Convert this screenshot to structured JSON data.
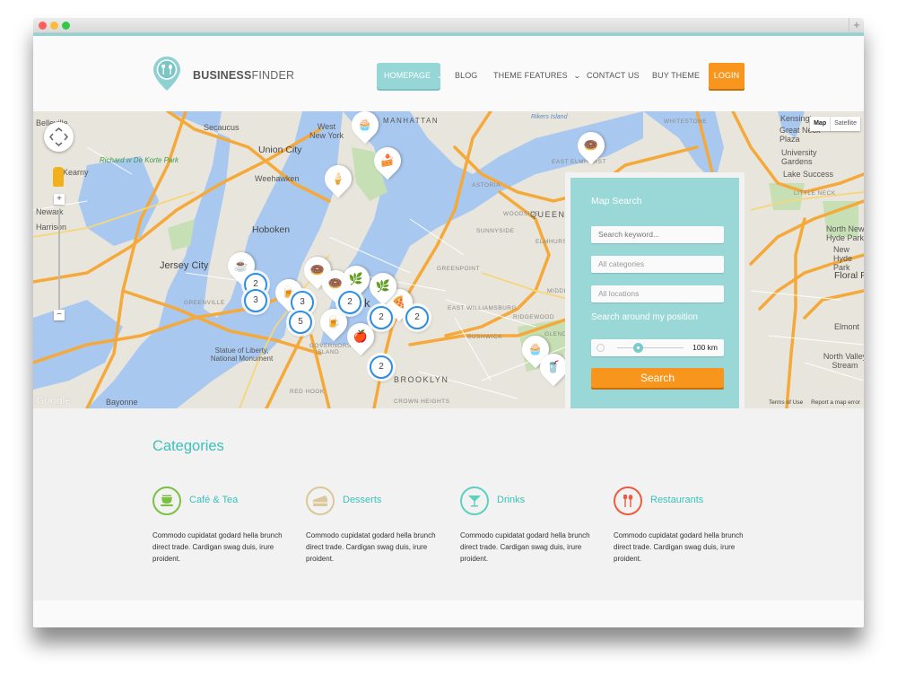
{
  "window": {
    "plus_label": "+"
  },
  "brand": {
    "bold": "BUSINESS",
    "light": "FINDER"
  },
  "nav": {
    "items": [
      {
        "label": "HOMEPAGE",
        "has_dropdown": true,
        "active": true
      },
      {
        "label": "BLOG",
        "has_dropdown": false
      },
      {
        "label": "THEME FEATURES",
        "has_dropdown": true
      },
      {
        "label": "CONTACT US",
        "has_dropdown": false
      },
      {
        "label": "BUY THEME",
        "has_dropdown": false
      }
    ],
    "login_label": "LOGIN",
    "chevron": "⌄"
  },
  "map": {
    "type_options": [
      "Map",
      "Satellite"
    ],
    "selected_type": "Map",
    "zoom_in": "+",
    "zoom_out": "−",
    "attribution": {
      "terms": "Terms of Use",
      "report": "Report a map error"
    },
    "logo": "Google",
    "labels": {
      "belleville": "Belleville",
      "secaucus": "Secaucus",
      "west_new_york": "West New York",
      "union_city": "Union City",
      "weehawken": "Weehawken",
      "hoboken": "Hoboken",
      "jersey_city": "Jersey City",
      "kearny": "Kearny",
      "newark": "Newark",
      "harrison": "Harrison",
      "bayonne": "Bayonne",
      "statue": "Statue of Liberty, National Monument",
      "richard_park": "Richard w De Korte Park",
      "manhattan": "MANHATTAN",
      "new_york": "York",
      "rikers": "Rikers Island",
      "east_elmhurst": "EAST ELMHURST",
      "astoria": "ASTORIA",
      "queens": "QUEENS",
      "woodside": "WOODSIDE",
      "sunnyside": "SUNNYSIDE",
      "elmhurst": "ELMHURST",
      "greenpoint": "GREENPOINT",
      "east_williamsburg": "EAST WILLIAMSBURG",
      "ridgewood": "RIDGEWOOD",
      "middle_village": "MIDDLE VILLAGE",
      "bushwick": "BUSHWICK",
      "glendale": "GLENDALE",
      "brooklyn": "BROOKLYN",
      "crown_heights": "CROWN HEIGHTS",
      "red_hook": "RED HOOK",
      "whitestone": "WHITESTONE",
      "kensington": "Kensingt",
      "great_neck": "Great Neck Plaza",
      "university_gardens": "University Gardens",
      "lake_success": "Lake Success",
      "little_neck": "LITTLE NECK",
      "north_new_hyde_park": "North New Hyde Park",
      "new_hyde_park": "New Hyde Park",
      "floral_park": "Floral Park",
      "elmont": "Elmont",
      "north_valley_stream": "North Valley Stream",
      "greenville": "GREENVILLE",
      "governors": "GOVERNORS ISLAND"
    },
    "clusters": [
      {
        "count": "2"
      },
      {
        "count": "3"
      },
      {
        "count": "3"
      },
      {
        "count": "2"
      },
      {
        "count": "5"
      },
      {
        "count": "2"
      },
      {
        "count": "2"
      },
      {
        "count": "2"
      }
    ],
    "markers": [
      {
        "category": "cafe-tea",
        "icon": "☕"
      },
      {
        "category": "drinks",
        "icon": "🍺"
      },
      {
        "category": "restaurants",
        "icon": "🍩"
      },
      {
        "category": "restaurants",
        "icon": "🍩"
      },
      {
        "category": "drinks",
        "icon": "🍺"
      },
      {
        "category": "restaurants",
        "icon": "🍎"
      },
      {
        "category": "desserts",
        "icon": "🍕"
      },
      {
        "category": "restaurants",
        "icon": "🌿"
      },
      {
        "category": "restaurants",
        "icon": "🌿"
      },
      {
        "category": "desserts",
        "icon": "🍦"
      },
      {
        "category": "cafe-tea",
        "icon": "🧁"
      },
      {
        "category": "desserts",
        "icon": "🍰"
      },
      {
        "category": "desserts",
        "icon": "🍩"
      },
      {
        "category": "cafe-tea",
        "icon": "🧁"
      },
      {
        "category": "drinks",
        "icon": "🥤"
      }
    ]
  },
  "search": {
    "title": "Map Search",
    "keyword_placeholder": "Search keyword...",
    "categories_placeholder": "All categories",
    "locations_placeholder": "All locations",
    "position_label": "Search around my position",
    "radius_value": "100 km",
    "radius_fraction": 0.25,
    "button_label": "Search"
  },
  "categories": {
    "title": "Categories",
    "items": [
      {
        "name": "Café & Tea",
        "desc": "Commodo cupidatat godard hella brunch direct trade. Cardigan swag duis, irure proident.",
        "color": "#7ac143",
        "icon": "cup-icon"
      },
      {
        "name": "Desserts",
        "desc": "Commodo cupidatat godard hella brunch direct trade. Cardigan swag duis, irure proident.",
        "color": "#d9c89a",
        "icon": "cake-icon"
      },
      {
        "name": "Drinks",
        "desc": "Commodo cupidatat godard hella brunch direct trade. Cardigan swag duis, irure proident.",
        "color": "#5fcfc0",
        "icon": "cocktail-icon"
      },
      {
        "name": "Restaurants",
        "desc": "Commodo cupidatat godard hella brunch direct trade. Cardigan swag duis, irure proident.",
        "color": "#ec5b42",
        "icon": "fork-spoon-icon"
      }
    ]
  },
  "colors": {
    "accent_teal": "#9ad7d7",
    "heading_teal": "#3cc1bb",
    "orange": "#f8951d"
  }
}
